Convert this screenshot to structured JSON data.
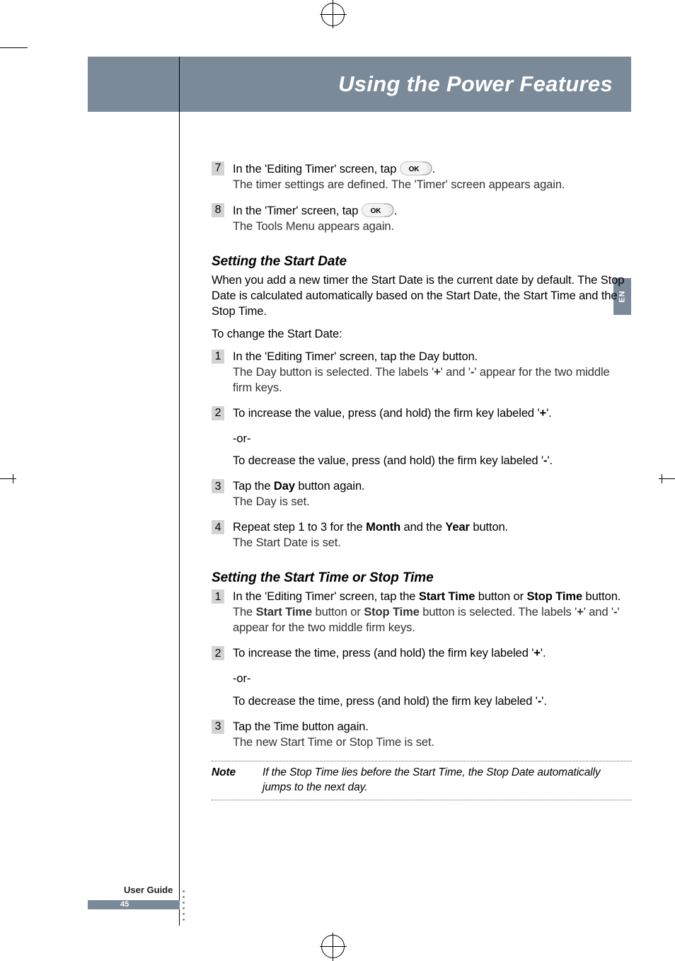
{
  "header": {
    "title": "Using the Power Features"
  },
  "side_tab": "EN",
  "intro_steps": [
    {
      "num": "7",
      "lead_a": "In the 'Editing Timer' screen, tap ",
      "lead_b": ".",
      "sub": "The timer settings are defined. The 'Timer' screen appears again."
    },
    {
      "num": "8",
      "lead_a": "In the 'Timer' screen, tap ",
      "lead_b": ".",
      "sub": "The Tools Menu appears again."
    }
  ],
  "section_date": {
    "heading": "Setting the Start Date",
    "para": "When you add a new timer the Start Date is the current date by default. The Stop Date is calculated automatically based on the Start Date, the Start Time and the Stop Time.",
    "lead": "To change the Start Date:",
    "step1": {
      "num": "1",
      "lead": "In the 'Editing Timer' screen, tap the Day button.",
      "sub_a": "The Day button is selected. The labels '",
      "plus": "+",
      "sub_b": "' and '",
      "minus": "-",
      "sub_c": "' appear for the two middle firm keys."
    },
    "step2": {
      "num": "2",
      "lead_a": "To increase the value, press (and hold) the firm key labeled '",
      "plus": "+",
      "lead_b": "'.",
      "or": "-or-",
      "alt_a": "To decrease the value, press (and hold) the firm key labeled '",
      "minus": "-",
      "alt_b": "'."
    },
    "step3": {
      "num": "3",
      "lead_a": "Tap the ",
      "bold": "Day",
      "lead_b": " button again.",
      "sub": "The Day is set."
    },
    "step4": {
      "num": "4",
      "lead_a": "Repeat step 1 to 3 for the ",
      "bold1": "Month",
      "mid": " and the ",
      "bold2": "Year",
      "lead_b": " button.",
      "sub": "The Start Date is set."
    }
  },
  "section_time": {
    "heading": "Setting the Start Time or Stop Time",
    "step1": {
      "num": "1",
      "lead_a": "In the 'Editing Timer' screen, tap the ",
      "bold1": "Start Time",
      "mid1": " button or ",
      "bold2": "Stop Time",
      "lead_b": " button.",
      "sub_a": "The ",
      "sub_bold1": "Start Time",
      "sub_mid1": " button or ",
      "sub_bold2": "Stop Time",
      "sub_mid2": " button is selected. The labels '",
      "plus": "+",
      "sub_mid3": "' and '",
      "minus": "-",
      "sub_b": "' appear for the two middle firm keys."
    },
    "step2": {
      "num": "2",
      "lead_a": "To increase the time, press (and hold) the firm key labeled '",
      "plus": "+",
      "lead_b": "'.",
      "or": "-or-",
      "alt_a": "To decrease the time, press (and hold) the firm key labeled '",
      "minus": "-",
      "alt_b": "'."
    },
    "step3": {
      "num": "3",
      "lead": "Tap the Time button again.",
      "sub": "The new Start Time or Stop Time is set."
    }
  },
  "note": {
    "label": "Note",
    "text": "If the Stop Time lies before the Start Time, the Stop Date automatically jumps to the next day."
  },
  "footer": {
    "guide": "User Guide",
    "page": "45"
  },
  "icons": {
    "ok": "OK"
  }
}
